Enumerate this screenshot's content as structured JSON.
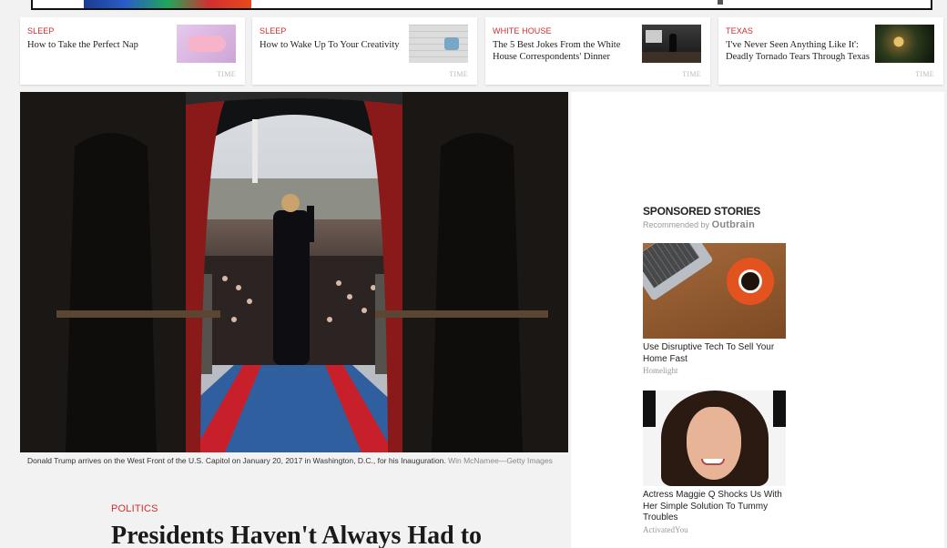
{
  "related": [
    {
      "kicker": "SLEEP",
      "headline": "How to Take the Perfect Nap",
      "source": "TIME",
      "thumb_icon": "sleep-mask-photo"
    },
    {
      "kicker": "SLEEP",
      "headline": "How to Wake Up To Your Creativity",
      "source": "TIME",
      "thumb_icon": "puzzle-photo"
    },
    {
      "kicker": "WHITE HOUSE",
      "headline": "The 5 Best Jokes From the White House Correspondents' Dinner",
      "source": "TIME",
      "thumb_icon": "comedian-on-stage-photo"
    },
    {
      "kicker": "TEXAS",
      "headline": "'I've Never Seen Anything Like It': Deadly Tornado Tears Through Texas",
      "source": "TIME",
      "thumb_icon": "tornado-night-photo"
    }
  ],
  "hero": {
    "caption": "Donald Trump arrives on the West Front of the U.S. Capitol on January 20, 2017 in Washington, D.C., for his Inauguration.",
    "credit": "Win McNamee—Getty Images"
  },
  "article": {
    "section": "POLITICS",
    "title": "Presidents Haven't Always Had to"
  },
  "sponsored": {
    "title": "SPONSORED STORIES",
    "recommended_by": "Recommended by",
    "brand": "Outbrain",
    "stories": [
      {
        "title": "Use Disruptive Tech To Sell Your Home Fast",
        "source": "Homelight"
      },
      {
        "title": "Actress Maggie Q Shocks Us With Her Simple Solution To Tummy Troubles",
        "source": "ActivatedYou"
      }
    ]
  },
  "colors": {
    "kicker": "#d62b2b",
    "carpet_blue": "#2f5f9e",
    "carpet_red": "#c8202a",
    "curtain": "#8a1a1a"
  }
}
